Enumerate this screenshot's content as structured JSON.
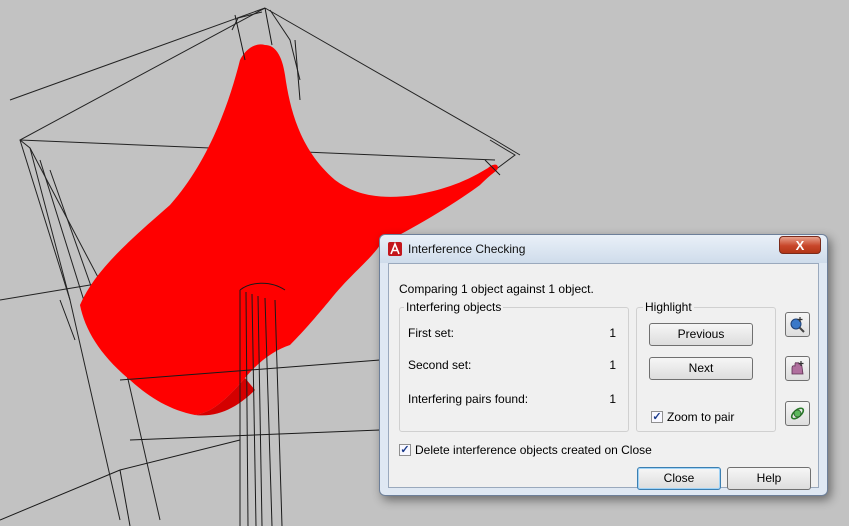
{
  "dialog": {
    "title": "Interference Checking",
    "close_glyph": "X",
    "comparing_text": "Comparing 1 object against 1 object.",
    "interfering_group": {
      "label": "Interfering objects",
      "rows": [
        {
          "label": "First set:",
          "value": "1"
        },
        {
          "label": "Second set:",
          "value": "1"
        },
        {
          "label": "Interfering pairs found:",
          "value": "1"
        }
      ]
    },
    "highlight_group": {
      "label": "Highlight",
      "previous_label": "Previous",
      "next_label": "Next",
      "zoom_to_pair_label": "Zoom to pair",
      "zoom_to_pair_checked": true
    },
    "delete_objects_label": "Delete interference objects created on Close",
    "delete_objects_checked": true,
    "close_label": "Close",
    "help_label": "Help",
    "side_icons": [
      "zoom-realtime-icon",
      "pan-realtime-icon",
      "orbit-icon"
    ]
  },
  "colors": {
    "surface": "#ff0000",
    "viewport_background": "#c2c2c2",
    "dialog_frame": "#dfe8f3",
    "close_button": "#c8462a"
  }
}
